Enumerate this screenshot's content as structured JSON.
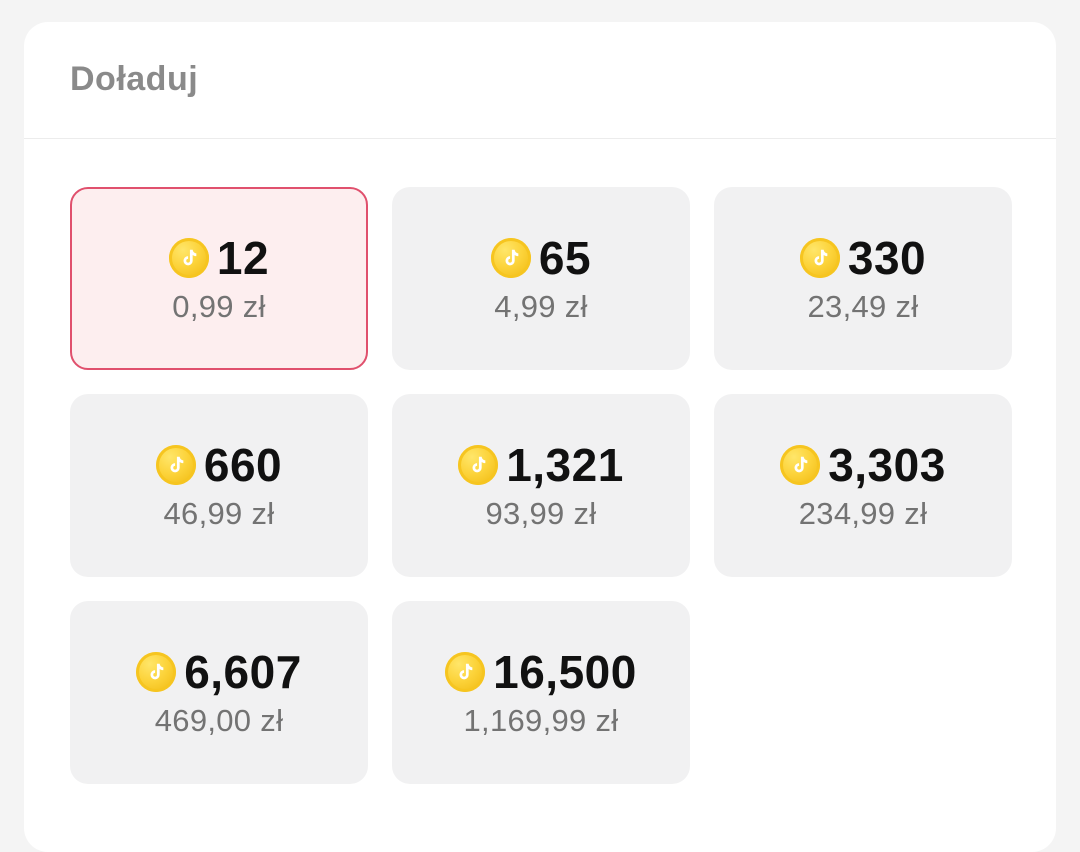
{
  "header": {
    "title": "Doładuj"
  },
  "packages": [
    {
      "coins": "12",
      "price": "0,99 zł",
      "selected": true
    },
    {
      "coins": "65",
      "price": "4,99 zł",
      "selected": false
    },
    {
      "coins": "330",
      "price": "23,49 zł",
      "selected": false
    },
    {
      "coins": "660",
      "price": "46,99 zł",
      "selected": false
    },
    {
      "coins": "1,321",
      "price": "93,99 zł",
      "selected": false
    },
    {
      "coins": "3,303",
      "price": "234,99 zł",
      "selected": false
    },
    {
      "coins": "6,607",
      "price": "469,00 zł",
      "selected": false
    },
    {
      "coins": "16,500",
      "price": "1,169,99 zł",
      "selected": false
    }
  ],
  "icons": {
    "coin": "tiktok-coin-icon"
  },
  "colors": {
    "selected_border": "#e0506d",
    "selected_background": "#fdeeef",
    "card_background": "#f1f1f2",
    "coin_gold": "#fcd33a"
  }
}
